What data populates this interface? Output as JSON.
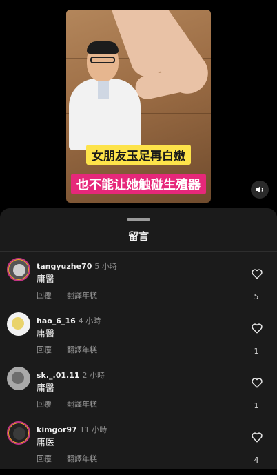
{
  "video": {
    "caption_line1": "女朋友玉足再白嫩",
    "caption_line2": "也不能让她触碰生殖器",
    "sound_icon": "volume-icon"
  },
  "sheet": {
    "title": "留言"
  },
  "comments": [
    {
      "username": "tangyuzhe70",
      "time": "5 小時",
      "text": "庸醫",
      "reply_label": "回覆",
      "translate_label": "翻譯年糕",
      "likes": "5",
      "avatar_color": "#cfcfcf"
    },
    {
      "username": "hao_6_16",
      "time": "4 小時",
      "text": "庸醫",
      "reply_label": "回覆",
      "translate_label": "翻譯年糕",
      "likes": "1",
      "avatar_color": "#e9d36a"
    },
    {
      "username": "sk._.01.11",
      "time": "2 小時",
      "text": "庸醫",
      "reply_label": "回覆",
      "translate_label": "翻譯年糕",
      "likes": "1",
      "avatar_color": "#6d6d6d"
    },
    {
      "username": "kimgor97",
      "time": "11 小時",
      "text": "庸医",
      "reply_label": "回覆",
      "translate_label": "翻譯年糕",
      "likes": "4",
      "avatar_color": "#3a3a3a"
    }
  ],
  "colors": {
    "background": "#000000",
    "sheet": "#1b1b1b",
    "story_ring": "#c13584",
    "caption_yellow": "#fde34a",
    "caption_pink": "#e6287a"
  }
}
